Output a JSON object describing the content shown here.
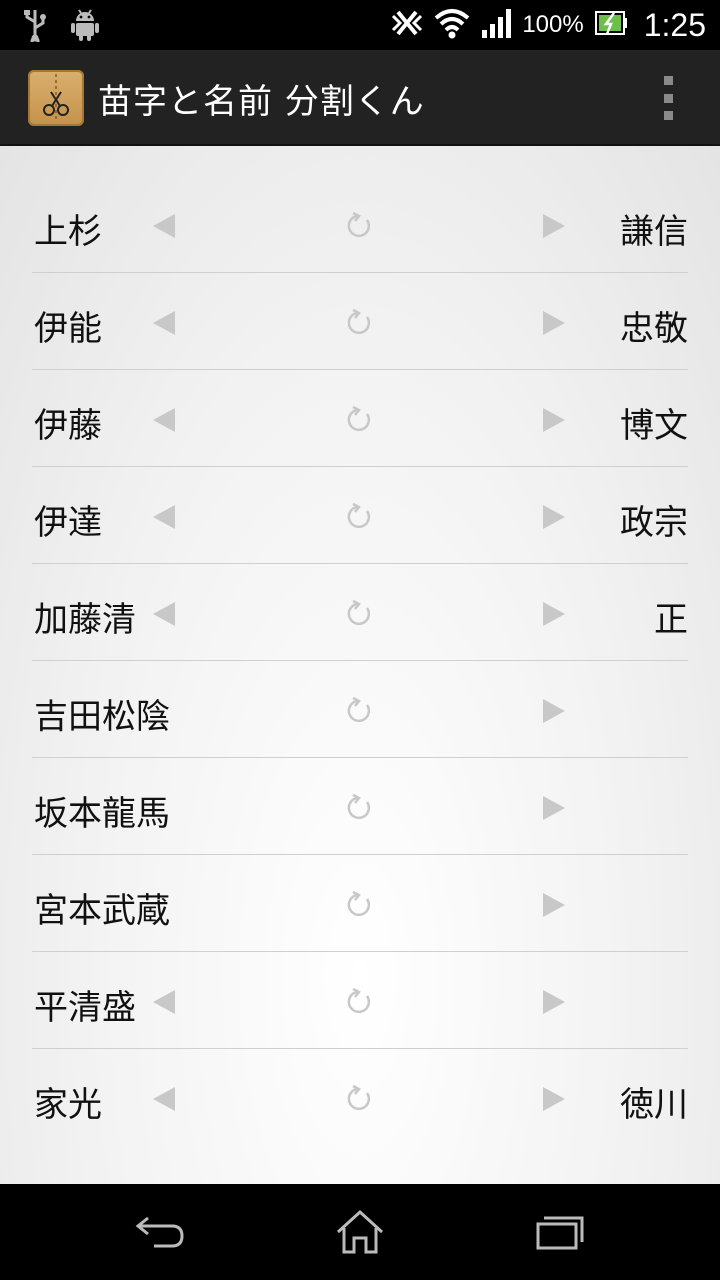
{
  "status_bar": {
    "battery_percent": "100%",
    "time": "1:25",
    "left_icons": [
      "usb-icon",
      "android-debug-icon"
    ],
    "right_icons": [
      "nfc-off-icon",
      "wifi-icon",
      "signal-icon",
      "battery-icon"
    ]
  },
  "action_bar": {
    "title": "苗字と名前 分割くん",
    "app_icon": "scissors-icon",
    "overflow_icon": "overflow-menu-icon"
  },
  "names": [
    {
      "surname": "上杉",
      "given": "謙信",
      "left_arrow": true
    },
    {
      "surname": "伊能",
      "given": "忠敬",
      "left_arrow": true
    },
    {
      "surname": "伊藤",
      "given": "博文",
      "left_arrow": true
    },
    {
      "surname": "伊達",
      "given": "政宗",
      "left_arrow": true
    },
    {
      "surname": "加藤清",
      "given": "正",
      "left_arrow": true
    },
    {
      "surname": "吉田松陰",
      "given": "",
      "left_arrow": false
    },
    {
      "surname": "坂本龍馬",
      "given": "",
      "left_arrow": false
    },
    {
      "surname": "宮本武蔵",
      "given": "",
      "left_arrow": false
    },
    {
      "surname": "平清盛",
      "given": "",
      "left_arrow": true
    },
    {
      "surname": "家光",
      "given": "徳川",
      "left_arrow": true
    }
  ],
  "colors": {
    "action_bar_bg": "#222222",
    "arrow_color": "#c8c8c8",
    "divider": "#cfcfcf"
  },
  "nav_bar": {
    "icons": [
      "back-icon",
      "home-icon",
      "recent-apps-icon"
    ]
  }
}
